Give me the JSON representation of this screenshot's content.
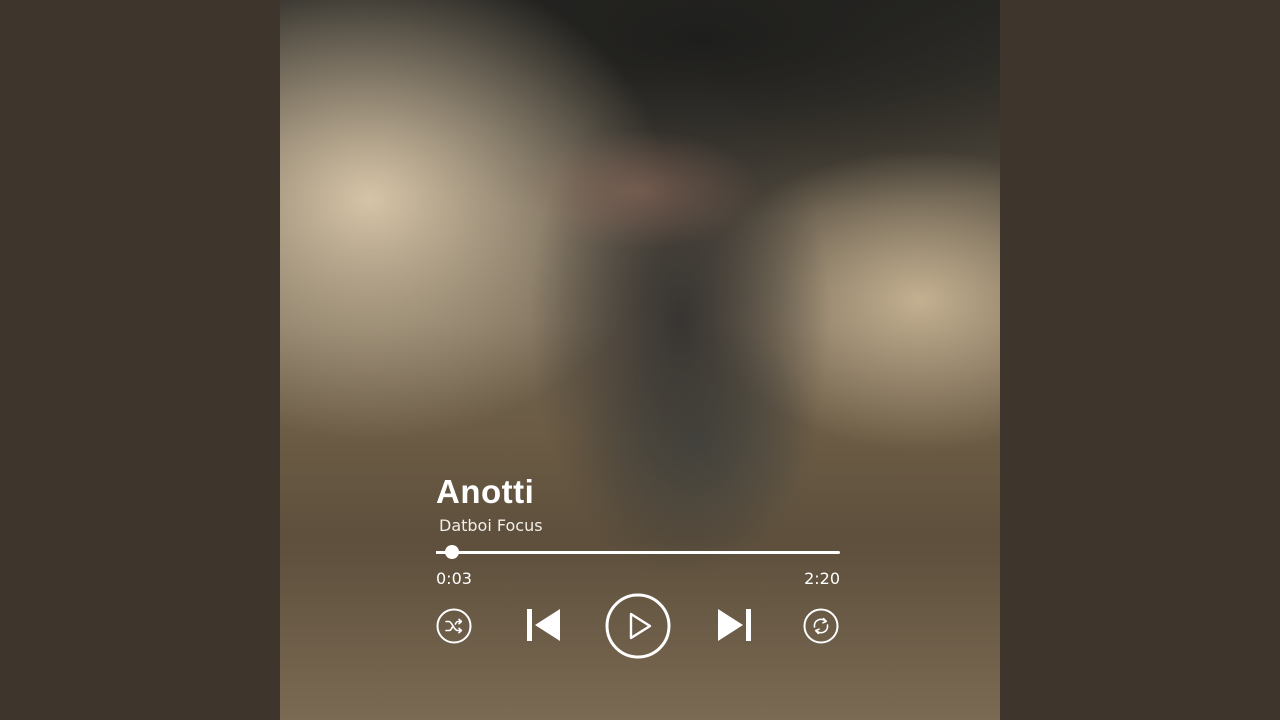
{
  "track": {
    "title": "Anotti",
    "artist": "Datboi Focus"
  },
  "playback": {
    "elapsed": "0:03",
    "total": "2:20",
    "progress_fraction": 0.0214,
    "state": "paused"
  },
  "controls": {
    "shuffle_icon": "shuffle-icon",
    "previous_icon": "skip-previous-icon",
    "play_icon": "play-icon",
    "next_icon": "skip-next-icon",
    "repeat_icon": "repeat-icon"
  },
  "colors": {
    "page_background": "#3e352d",
    "foreground": "#ffffff"
  }
}
